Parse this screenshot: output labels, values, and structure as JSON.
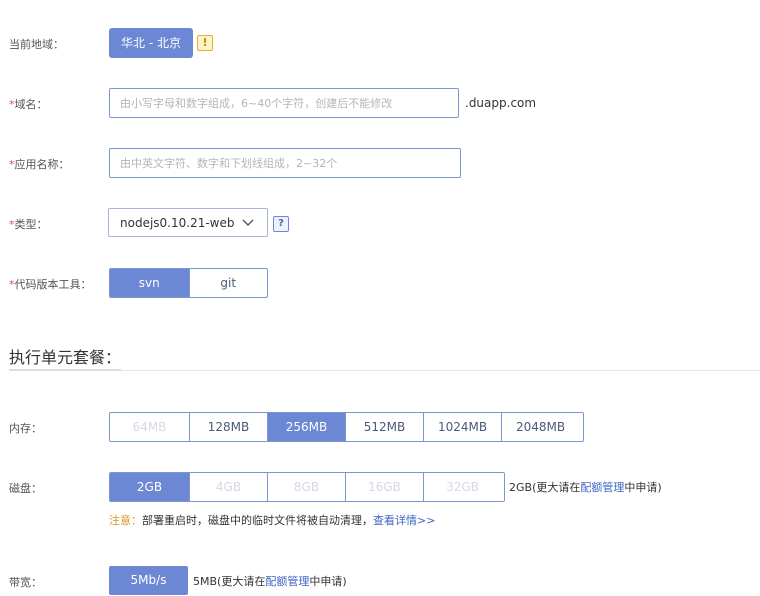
{
  "region": {
    "label": "当前地域：",
    "value": "华北 - 北京",
    "warn_glyph": "!"
  },
  "domain": {
    "required": "*",
    "label": "域名：",
    "placeholder": "由小写字母和数字组成，6~40个字符，创建后不能修改",
    "value": "",
    "suffix": ".duapp.com"
  },
  "app_name": {
    "required": "*",
    "label": "应用名称：",
    "placeholder": "由中英文字符、数字和下划线组成，2~32个",
    "value": ""
  },
  "type": {
    "required": "*",
    "label": "类型：",
    "selected": "nodejs0.10.21-web",
    "help_glyph": "?"
  },
  "vcs": {
    "required": "*",
    "label": "代码版本工具：",
    "options": [
      "svn",
      "git"
    ],
    "selected": "svn"
  },
  "section": {
    "title": "执行单元套餐："
  },
  "memory": {
    "label": "内存：",
    "options": [
      "64MB",
      "128MB",
      "256MB",
      "512MB",
      "1024MB",
      "2048MB"
    ],
    "selected": "256MB",
    "disabled": [
      "64MB"
    ]
  },
  "disk": {
    "label": "磁盘：",
    "options": [
      "2GB",
      "4GB",
      "8GB",
      "16GB",
      "32GB"
    ],
    "selected": "2GB",
    "disabled": [
      "4GB",
      "8GB",
      "16GB",
      "32GB"
    ],
    "note_prefix": "2GB(更大请在",
    "note_link": "配额管理",
    "note_suffix": "中申请)",
    "tip_highlight": "注意：",
    "tip_text": "部署重启时，磁盘中的临时文件将被自动清理，",
    "tip_link": "查看详情>>"
  },
  "bandwidth": {
    "label": "带宽：",
    "value": "5Mb/s",
    "note_prefix": "5MB(更大请在",
    "note_link": "配额管理",
    "note_suffix": "中申请)"
  },
  "colors": {
    "accent": "#6c87d3",
    "border": "#7d96cf",
    "required": "#e24b4b",
    "warn": "#e0922b",
    "link": "#3e64c4"
  },
  "icons": [
    "warning-icon",
    "help-icon",
    "chevron-down-icon"
  ]
}
